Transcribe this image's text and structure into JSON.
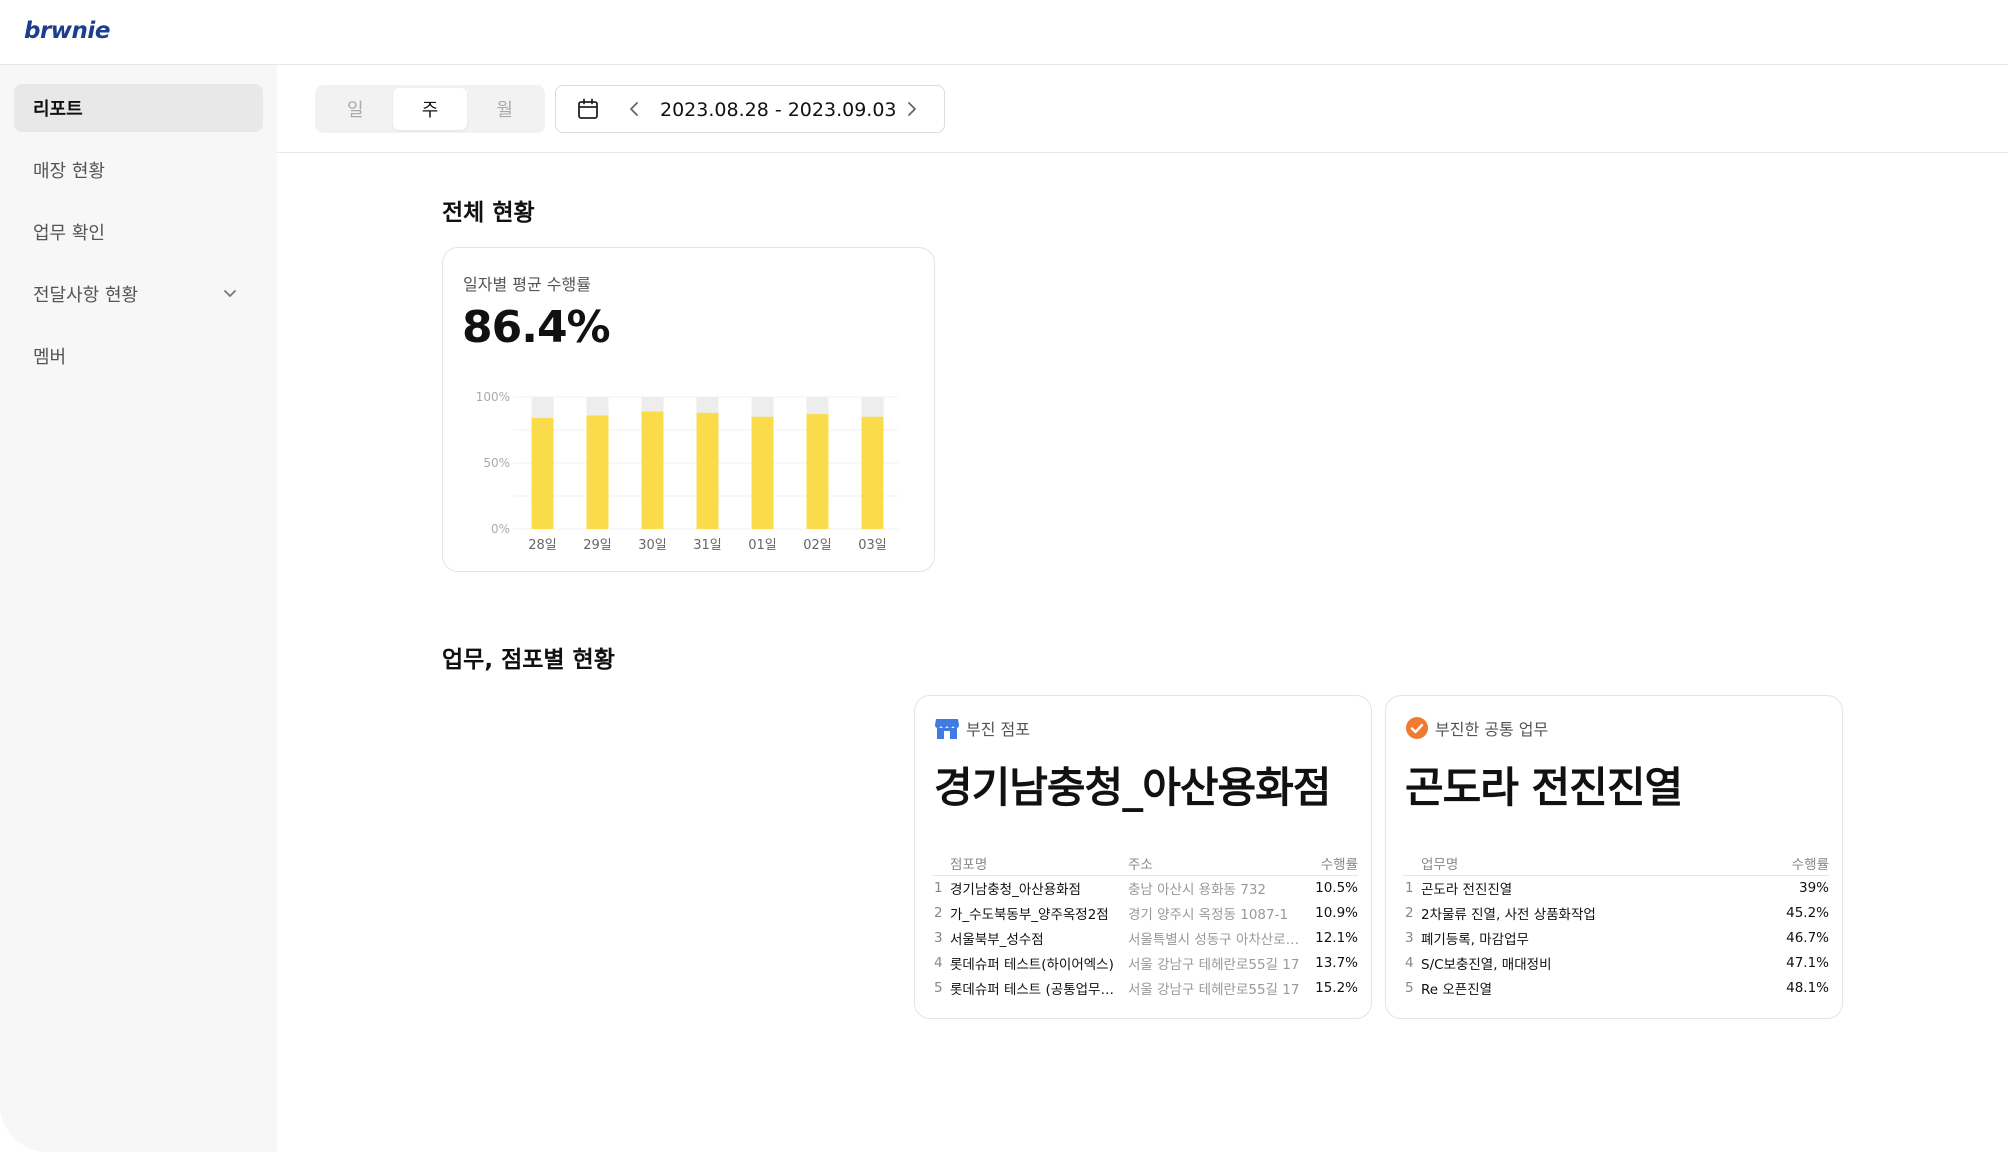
{
  "header": {
    "logo": "brwnie"
  },
  "sidebar": {
    "items": [
      {
        "label": "리포트"
      },
      {
        "label": "매장 현황"
      },
      {
        "label": "업무 확인"
      },
      {
        "label": "전달사항 현황"
      },
      {
        "label": "멤버"
      }
    ]
  },
  "filter": {
    "periods": [
      "일",
      "주",
      "월"
    ],
    "selected_period": "주",
    "date_range": "2023.08.28 - 2023.09.03"
  },
  "overview": {
    "section_title": "전체 현황",
    "card_label": "일자별 평균 수행률",
    "value": "86.4%"
  },
  "chart_data": {
    "type": "bar",
    "categories": [
      "28일",
      "29일",
      "30일",
      "31일",
      "01일",
      "02일",
      "03일"
    ],
    "values": [
      84,
      86,
      89,
      88,
      85,
      87,
      85
    ],
    "y_ticks": [
      "100%",
      "50%",
      "0%"
    ],
    "ylim": [
      0,
      100
    ],
    "bar_color": "#fadc4b",
    "track_color": "#ededed"
  },
  "detail": {
    "section_title": "업무, 점포별 현황",
    "stores": {
      "label": "부진 점포",
      "title": "경기남충청_아산용화점",
      "headers": {
        "name": "점포명",
        "address": "주소",
        "rate": "수행률"
      },
      "rows": [
        {
          "idx": "1",
          "name": "경기남충청_아산용화점",
          "address": "충남 아산시 용화동 732",
          "rate": "10.5%"
        },
        {
          "idx": "2",
          "name": "가_수도북동부_양주옥정2점",
          "address": "경기 양주시 옥정동 1087-1",
          "rate": "10.9%"
        },
        {
          "idx": "3",
          "name": "서울북부_성수점",
          "address": "서울특별시 성동구 아차산로…",
          "rate": "12.1%"
        },
        {
          "idx": "4",
          "name": "롯데슈퍼 테스트(하이어엑스)",
          "address": "서울 강남구 테헤란로55길 17",
          "rate": "13.7%"
        },
        {
          "idx": "5",
          "name": "롯데슈퍼 테스트 (공통업무…",
          "address": "서울 강남구 테헤란로55길 17",
          "rate": "15.2%"
        }
      ]
    },
    "tasks": {
      "label": "부진한 공통 업무",
      "title": "곤도라 전진진열",
      "headers": {
        "name": "업무명",
        "rate": "수행률"
      },
      "rows": [
        {
          "idx": "1",
          "name": "곤도라 전진진열",
          "rate": "39%"
        },
        {
          "idx": "2",
          "name": "2차물류 진열, 사전 상품화작업",
          "rate": "45.2%"
        },
        {
          "idx": "3",
          "name": "폐기등록, 마감업무",
          "rate": "46.7%"
        },
        {
          "idx": "4",
          "name": "S/C보충진열, 매대정비",
          "rate": "47.1%"
        },
        {
          "idx": "5",
          "name": "Re 오픈진열",
          "rate": "48.1%"
        }
      ]
    }
  },
  "colors": {
    "brand": "#1d3e8c",
    "store_icon": "#3f7be0",
    "task_icon": "#ef7a30"
  }
}
